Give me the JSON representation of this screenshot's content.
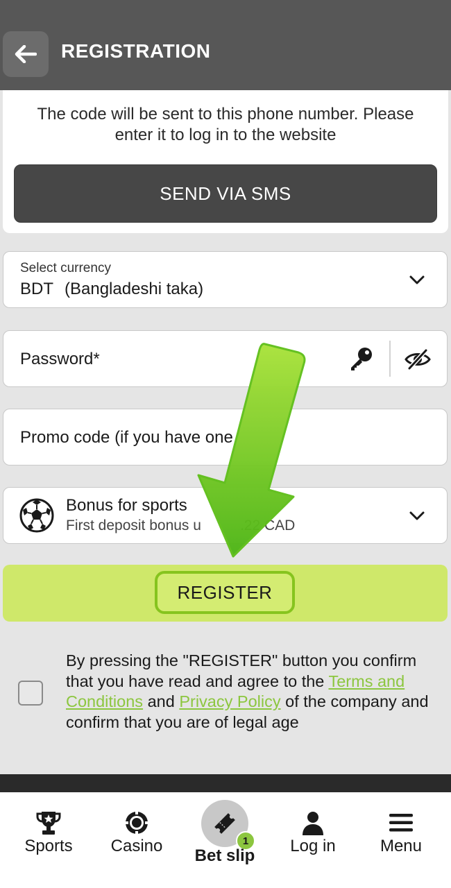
{
  "header": {
    "title": "REGISTRATION",
    "back_icon": "arrow-left-icon"
  },
  "sms_section": {
    "info_text": "The code will be sent to this phone number. Please enter it to log in to the website",
    "send_button_label": "SEND VIA SMS"
  },
  "currency_field": {
    "label": "Select currency",
    "code": "BDT",
    "name": "(Bangladeshi taka)"
  },
  "password_field": {
    "placeholder": "Password*"
  },
  "promo_field": {
    "placeholder": "Promo code (if you have one"
  },
  "bonus_field": {
    "title": "Bonus for sports",
    "subtitle": "First deposit bonus u",
    "subtitle_tail": ".22 CAD"
  },
  "register_button": {
    "label": "REGISTER"
  },
  "agreement": {
    "checked": false,
    "text_before": "By pressing the \"REGISTER\" button you confirm that you have read and agree to the ",
    "terms_link": "Terms and Conditions",
    "text_and": " and ",
    "privacy_link": "Privacy Policy",
    "text_after": " of the company and confirm that you are of legal age"
  },
  "bottom_nav": {
    "sports": "Sports",
    "casino": "Casino",
    "bet_slip": "Bet slip",
    "bet_slip_count": "1",
    "login": "Log in",
    "menu": "Menu"
  },
  "colors": {
    "header_bg": "#575757",
    "accent_green": "#8cc63f",
    "register_band": "#cfe86a",
    "sms_button": "#474747"
  }
}
